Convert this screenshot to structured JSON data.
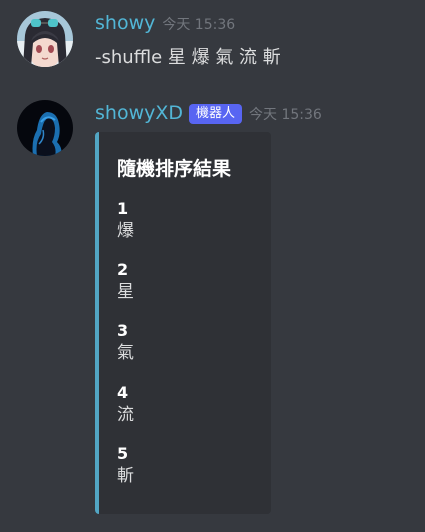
{
  "messages": [
    {
      "username": "showy",
      "timestamp": "今天 15:36",
      "content": "-shuffle 星 爆 氣 流 斬"
    },
    {
      "username": "showyXD",
      "badge": "機器人",
      "timestamp": "今天 15:36",
      "embed": {
        "title": "隨機排序結果",
        "fields": [
          {
            "name": "1",
            "value": "爆"
          },
          {
            "name": "2",
            "value": "星"
          },
          {
            "name": "3",
            "value": "氣"
          },
          {
            "name": "4",
            "value": "流"
          },
          {
            "name": "5",
            "value": "斬"
          }
        ],
        "accent_color": "#52a6c4"
      }
    }
  ],
  "colors": {
    "background": "#36393f",
    "username": "#52b6d6",
    "bot_badge": "#5865f2",
    "embed_background": "#2f3136",
    "timestamp": "#72767d"
  }
}
